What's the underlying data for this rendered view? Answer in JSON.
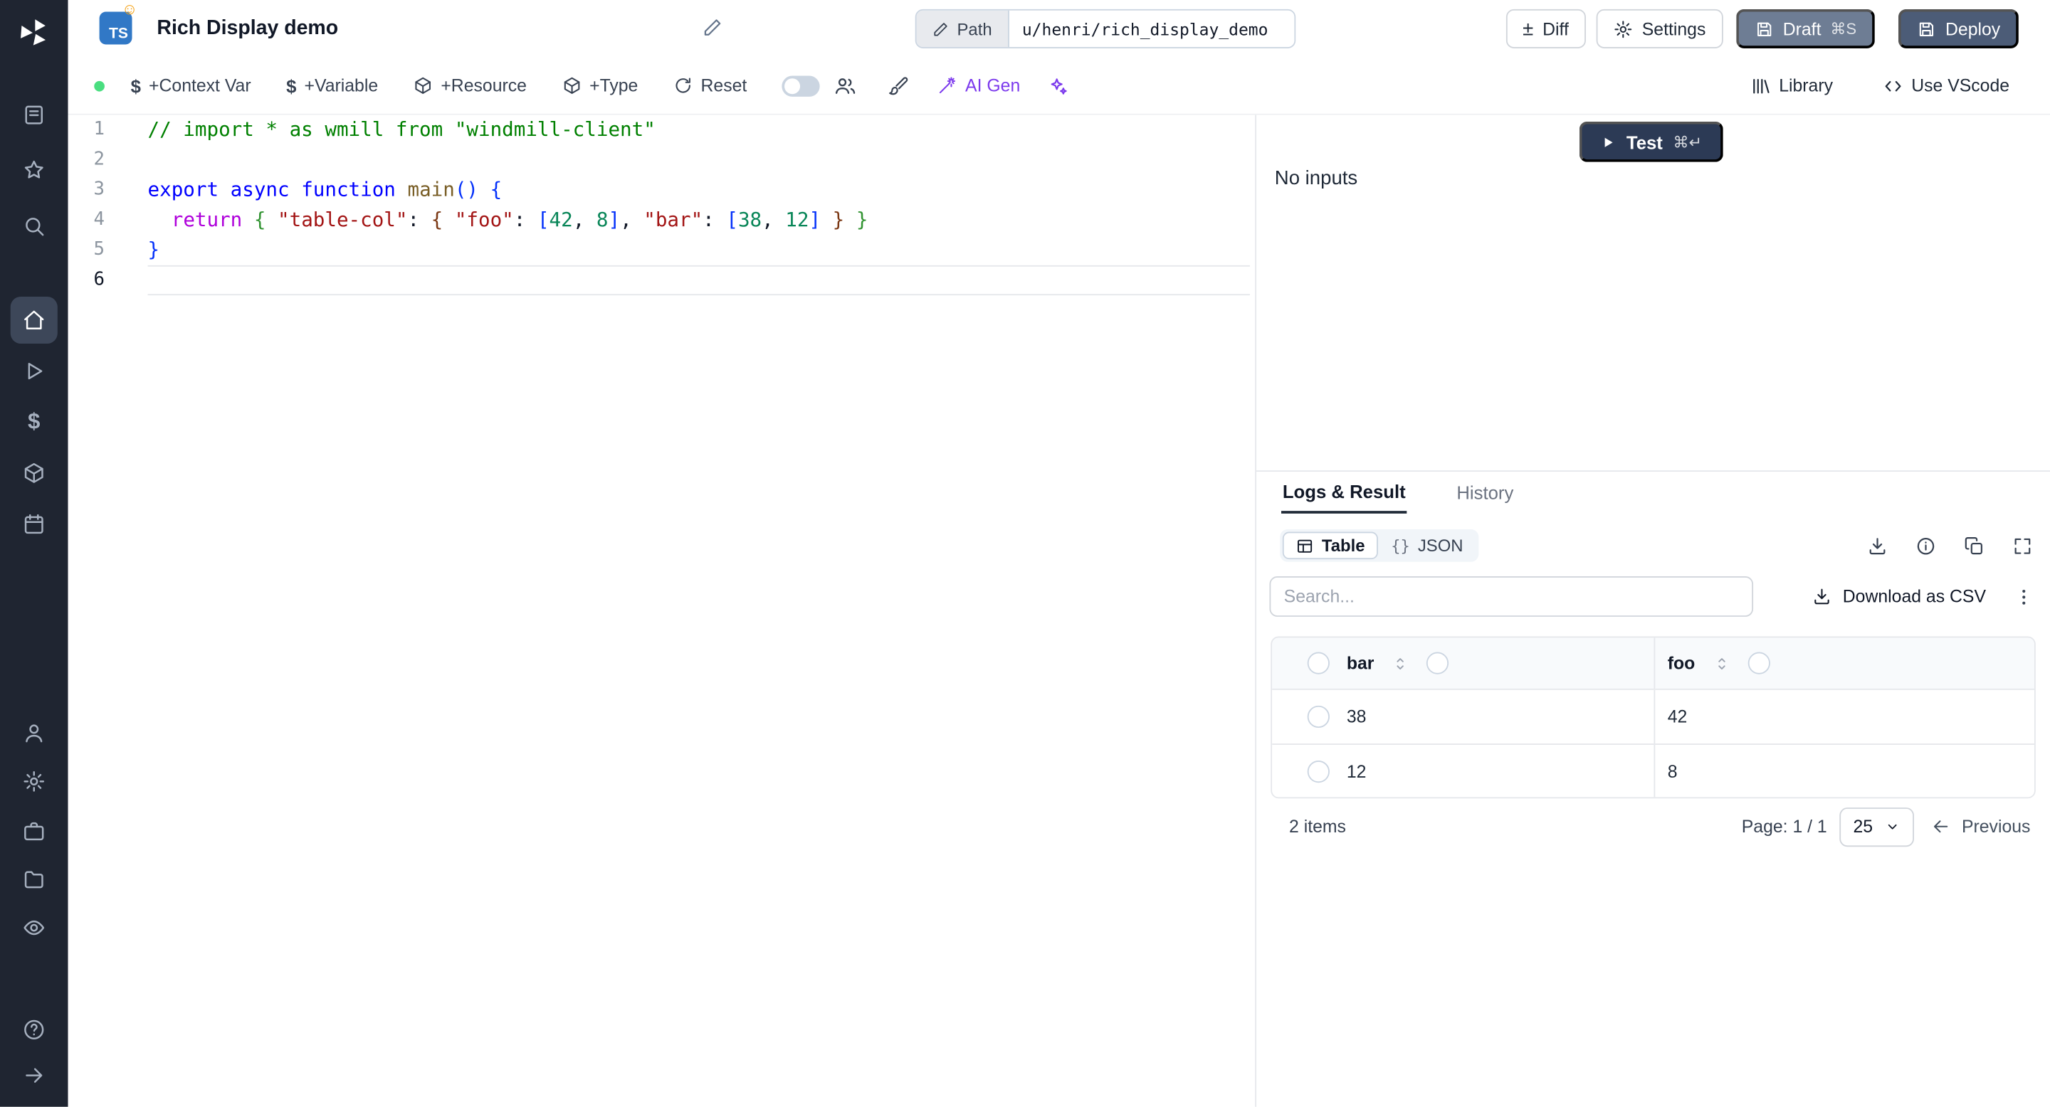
{
  "header": {
    "lang_badge": "TS",
    "title": "Rich Display demo",
    "path_label": "Path",
    "path_value": "u/henri/rich_display_demo",
    "diff": "Diff",
    "settings": "Settings",
    "draft": "Draft",
    "draft_shortcut": "⌘S",
    "deploy": "Deploy"
  },
  "toolbar": {
    "context_var": "+Context Var",
    "variable": "+Variable",
    "resource": "+Resource",
    "type": "+Type",
    "reset": "Reset",
    "ai_gen": "AI Gen",
    "library": "Library",
    "use_vscode": "Use VScode"
  },
  "editor": {
    "lines": [
      {
        "n": "1",
        "segs": [
          {
            "t": "// import * as wmill from \"windmill-client\"",
            "c": "cm"
          }
        ]
      },
      {
        "n": "2",
        "segs": []
      },
      {
        "n": "3",
        "segs": [
          {
            "t": "export",
            "c": "kw"
          },
          {
            "t": " ",
            "c": "pl"
          },
          {
            "t": "async",
            "c": "kw"
          },
          {
            "t": " ",
            "c": "pl"
          },
          {
            "t": "function",
            "c": "kw"
          },
          {
            "t": " ",
            "c": "pl"
          },
          {
            "t": "main",
            "c": "fn"
          },
          {
            "t": "(",
            "c": "b1"
          },
          {
            "t": ")",
            "c": "b1"
          },
          {
            "t": " ",
            "c": "pl"
          },
          {
            "t": "{",
            "c": "b1"
          }
        ]
      },
      {
        "n": "4",
        "segs": [
          {
            "t": "  ",
            "c": "pl"
          },
          {
            "t": "return",
            "c": "ct"
          },
          {
            "t": " ",
            "c": "pl"
          },
          {
            "t": "{",
            "c": "b2"
          },
          {
            "t": " ",
            "c": "pl"
          },
          {
            "t": "\"table-col\"",
            "c": "st"
          },
          {
            "t": ": ",
            "c": "pl"
          },
          {
            "t": "{",
            "c": "b3"
          },
          {
            "t": " ",
            "c": "pl"
          },
          {
            "t": "\"foo\"",
            "c": "st"
          },
          {
            "t": ": ",
            "c": "pl"
          },
          {
            "t": "[",
            "c": "b1"
          },
          {
            "t": "42",
            "c": "nu"
          },
          {
            "t": ", ",
            "c": "pl"
          },
          {
            "t": "8",
            "c": "nu"
          },
          {
            "t": "]",
            "c": "b1"
          },
          {
            "t": ", ",
            "c": "pl"
          },
          {
            "t": "\"bar\"",
            "c": "st"
          },
          {
            "t": ": ",
            "c": "pl"
          },
          {
            "t": "[",
            "c": "b1"
          },
          {
            "t": "38",
            "c": "nu"
          },
          {
            "t": ", ",
            "c": "pl"
          },
          {
            "t": "12",
            "c": "nu"
          },
          {
            "t": "]",
            "c": "b1"
          },
          {
            "t": " ",
            "c": "pl"
          },
          {
            "t": "}",
            "c": "b3"
          },
          {
            "t": " ",
            "c": "pl"
          },
          {
            "t": "}",
            "c": "b2"
          }
        ]
      },
      {
        "n": "5",
        "segs": [
          {
            "t": "}",
            "c": "b1"
          }
        ]
      },
      {
        "n": "6",
        "segs": [],
        "current": true
      }
    ]
  },
  "test_panel": {
    "test": "Test",
    "shortcut": "⌘↵",
    "no_inputs": "No inputs"
  },
  "result_panel": {
    "tabs": [
      {
        "label": "Logs & Result",
        "active": true
      },
      {
        "label": "History",
        "active": false
      }
    ],
    "views": [
      {
        "label": "Table",
        "active": true
      },
      {
        "label": "JSON",
        "active": false
      }
    ],
    "json_prefix": "{}",
    "search_placeholder": "Search...",
    "download_csv": "Download as CSV",
    "table": {
      "columns": [
        "bar",
        "foo"
      ],
      "rows": [
        [
          "38",
          "42"
        ],
        [
          "12",
          "8"
        ]
      ],
      "items": "2 items",
      "page": "Page: 1 / 1",
      "page_size": "25",
      "previous": "Previous"
    }
  }
}
